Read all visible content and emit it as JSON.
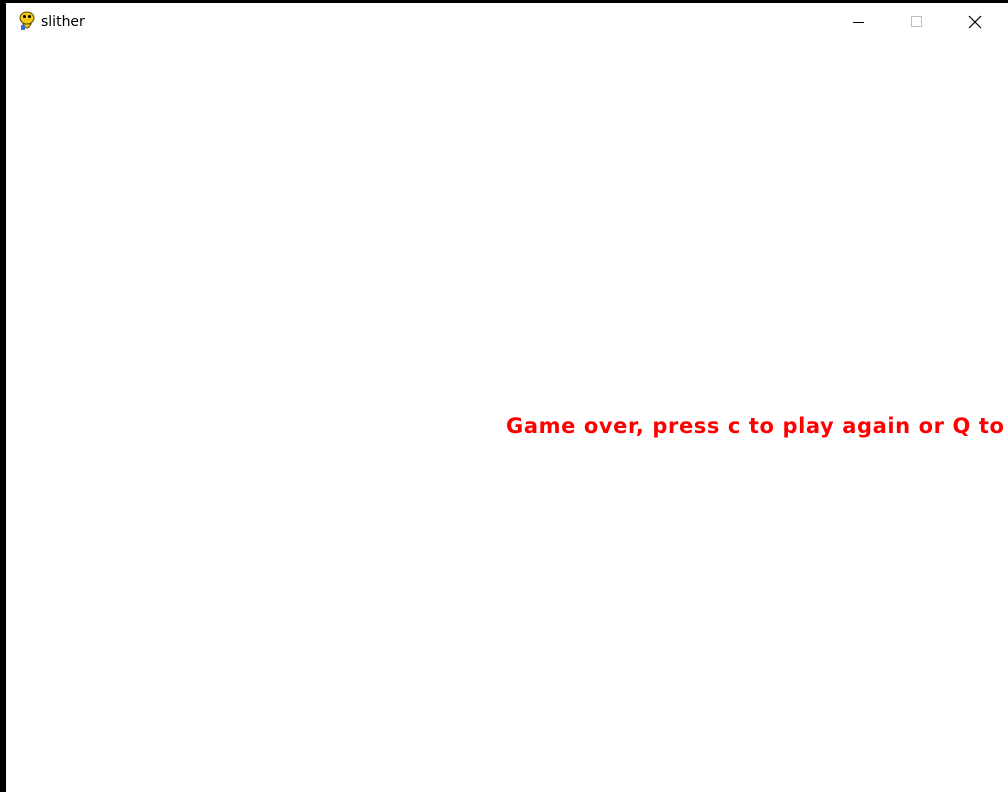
{
  "window": {
    "title": "slither",
    "app_icon": "pygame-snake-icon",
    "controls": {
      "minimize_icon": "minimize-icon",
      "maximize_icon": "maximize-icon",
      "close_icon": "close-icon"
    }
  },
  "game": {
    "background_color": "#ffffff",
    "message": "Game over, press c to play again or Q to qui",
    "message_color": "#ff0000"
  }
}
